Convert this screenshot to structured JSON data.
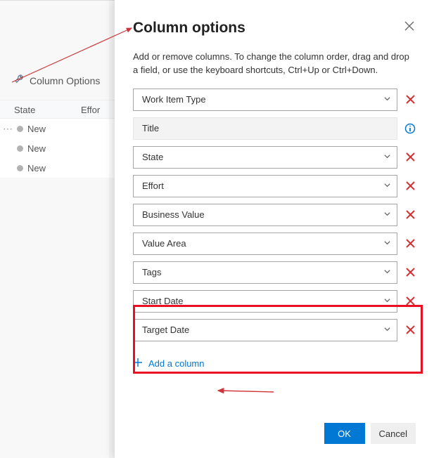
{
  "background": {
    "columnOptionsLabel": "Column Options",
    "headers": {
      "state": "State",
      "effort": "Effor"
    },
    "rows": [
      {
        "state": "New",
        "hover": true
      },
      {
        "state": "New",
        "hover": false
      },
      {
        "state": "New",
        "hover": false
      }
    ]
  },
  "panel": {
    "title": "Column options",
    "description": "Add or remove columns. To change the column order, drag and drop a field, or use the keyboard shortcuts, Ctrl+Up or Ctrl+Down.",
    "columns": [
      {
        "label": "Work Item Type",
        "locked": false,
        "removable": true
      },
      {
        "label": "Title",
        "locked": true,
        "removable": false
      },
      {
        "label": "State",
        "locked": false,
        "removable": true
      },
      {
        "label": "Effort",
        "locked": false,
        "removable": true
      },
      {
        "label": "Business Value",
        "locked": false,
        "removable": true
      },
      {
        "label": "Value Area",
        "locked": false,
        "removable": true
      },
      {
        "label": "Tags",
        "locked": false,
        "removable": true
      },
      {
        "label": "Start Date",
        "locked": false,
        "removable": true
      },
      {
        "label": "Target Date",
        "locked": false,
        "removable": true
      }
    ],
    "addColumn": "Add a column",
    "buttons": {
      "ok": "OK",
      "cancel": "Cancel"
    }
  }
}
